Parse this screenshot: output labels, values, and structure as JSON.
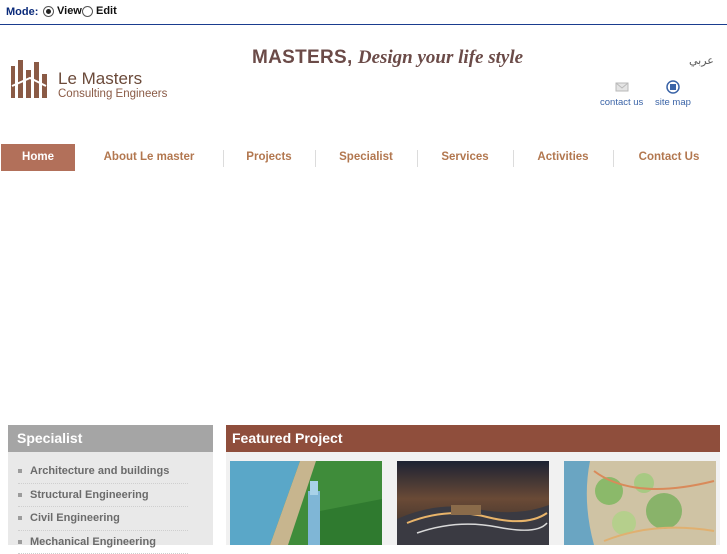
{
  "mode_bar": {
    "label": "Mode:",
    "options": [
      "View",
      "Edit"
    ],
    "selected": "View"
  },
  "logo": {
    "title": "Le Masters",
    "subtitle": "Consulting Engineers"
  },
  "tagline": {
    "brand": "MASTERS,",
    "script": "Design your life style"
  },
  "language_link": "عربي",
  "utility": {
    "contact": "contact us",
    "sitemap": "site map"
  },
  "nav": {
    "active": "Home",
    "items": [
      "Home",
      "About Le master",
      "Projects",
      "Specialist",
      "Services",
      "Activities",
      "Contact Us"
    ]
  },
  "specialist": {
    "title": "Specialist",
    "items": [
      "Architecture and buildings",
      "Structural Engineering",
      "Civil Engineering",
      "Mechanical Engineering"
    ]
  },
  "featured": {
    "title": "Featured Project"
  },
  "colors": {
    "nav_active_bg": "#b2705a",
    "nav_text": "#b2774f",
    "featured_header": "#8f4e3c",
    "specialist_header": "#a5a5a5"
  }
}
